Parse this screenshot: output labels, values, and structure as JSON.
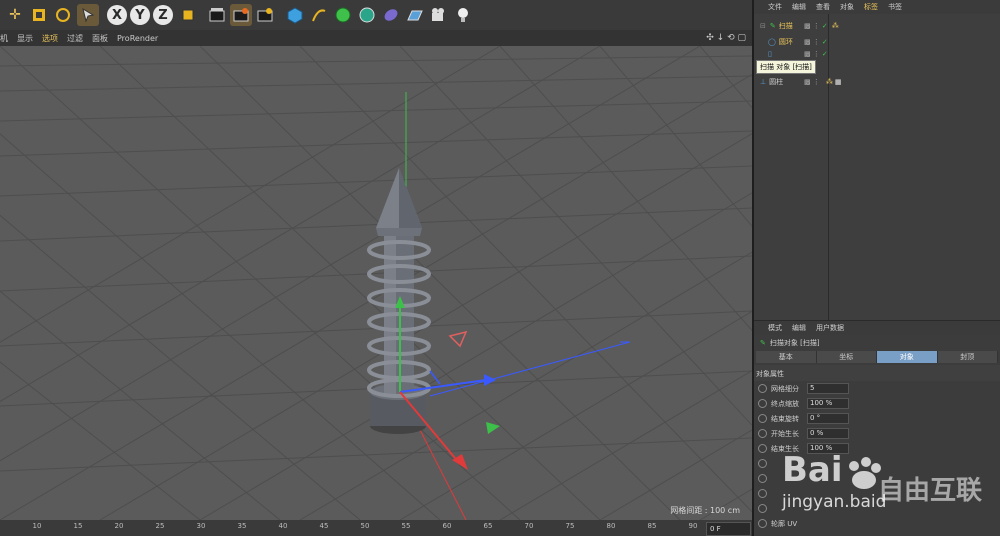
{
  "viewport_menu": [
    "机",
    "显示",
    "选项",
    "过滤",
    "面板",
    "ProRender"
  ],
  "viewport_menu_highlight": "选项",
  "viewport_info": "网格间距 : 100 cm",
  "timeline": {
    "ticks": [
      "10",
      "15",
      "20",
      "25",
      "30",
      "35",
      "40",
      "45",
      "50",
      "55",
      "60",
      "65",
      "70",
      "75",
      "80",
      "85",
      "90"
    ],
    "frame": "0 F"
  },
  "object_manager": {
    "menu": [
      "文件",
      "编辑",
      "查看",
      "对象",
      "标签",
      "书签"
    ],
    "active_menu": "标签",
    "objects": [
      {
        "name": "扫描",
        "color": "#e8c35a"
      },
      {
        "name": "圆环",
        "color": "#e8c35a"
      },
      {
        "name": "",
        "color": "#cfcfcf"
      },
      {
        "name": "圆柱",
        "color": "#cfcfcf"
      }
    ],
    "tooltip": "扫描 对象 [扫描]"
  },
  "attribute_manager": {
    "menu": [
      "模式",
      "编辑",
      "用户数据"
    ],
    "title": "扫描对象 [扫描]",
    "tabs": [
      "基本",
      "坐标",
      "对象",
      "封顶"
    ],
    "active_tab": "对象",
    "section": "对象属性",
    "props": [
      {
        "label": "网格细分",
        "value": "5"
      },
      {
        "label": "终点缩放",
        "value": "100 %"
      },
      {
        "label": "结束旋转",
        "value": "0 °"
      },
      {
        "label": "开始生长",
        "value": "0 %"
      },
      {
        "label": "结束生长",
        "value": "100 %"
      },
      {
        "label": "",
        "value": ""
      },
      {
        "label": "",
        "value": ""
      },
      {
        "label": "",
        "value": ""
      },
      {
        "label": "",
        "value": ""
      },
      {
        "label": "轮廓 UV",
        "value": ""
      }
    ]
  },
  "watermark": {
    "line1": "Bai",
    "line2": "jingyan.baid",
    "brand": "自由互联"
  }
}
